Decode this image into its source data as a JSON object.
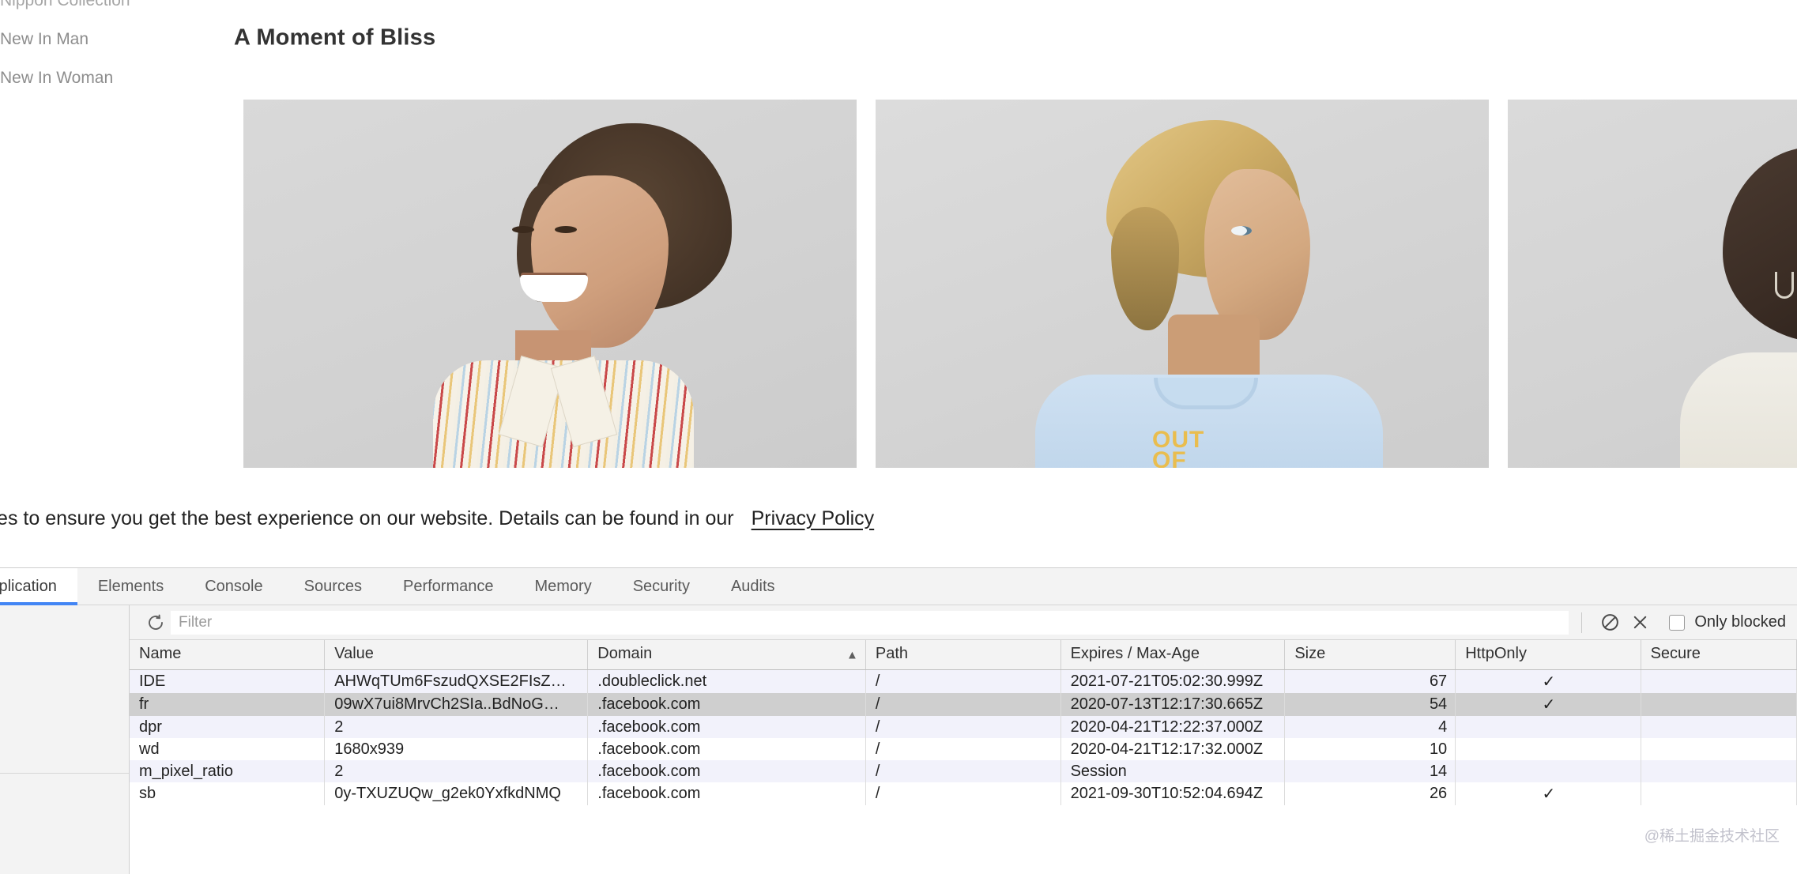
{
  "site": {
    "nav": [
      {
        "label": "Nippon Collection"
      },
      {
        "label": "New In Man"
      },
      {
        "label": "New In Woman"
      }
    ],
    "heading": "A Moment of Bliss",
    "gallery": [
      {
        "alt": "smiling-man-striped-shirt",
        "tee_text": ""
      },
      {
        "alt": "blond-man-profile-blue-tee",
        "tee_text": "OUT\nOF"
      },
      {
        "alt": "woman-cream-sweater",
        "tee_text": ""
      }
    ],
    "cookie_banner": {
      "text": "kies to ensure you get the best experience on our website. Details can be found in our",
      "link_label": "Privacy Policy"
    }
  },
  "devtools": {
    "tabs": [
      {
        "label": "Application",
        "active": true
      },
      {
        "label": "Elements",
        "active": false
      },
      {
        "label": "Console",
        "active": false
      },
      {
        "label": "Sources",
        "active": false
      },
      {
        "label": "Performance",
        "active": false
      },
      {
        "label": "Memory",
        "active": false
      },
      {
        "label": "Security",
        "active": false
      },
      {
        "label": "Audits",
        "active": false
      }
    ],
    "toolbar": {
      "refresh_icon": "refresh-icon",
      "filter_placeholder": "Filter",
      "filter_value": "",
      "clear_filter_icon": "block-icon",
      "delete_icon": "close-icon",
      "only_blocked_label": "Only blocked",
      "only_blocked_checked": false
    },
    "table": {
      "columns": [
        {
          "key": "name",
          "label": "Name",
          "sorted": false
        },
        {
          "key": "value",
          "label": "Value",
          "sorted": false
        },
        {
          "key": "domain",
          "label": "Domain",
          "sorted": true,
          "sort_dir": "▲"
        },
        {
          "key": "path",
          "label": "Path",
          "sorted": false
        },
        {
          "key": "expires",
          "label": "Expires / Max-Age",
          "sorted": false
        },
        {
          "key": "size",
          "label": "Size",
          "sorted": false
        },
        {
          "key": "httponly",
          "label": "HttpOnly",
          "sorted": false
        },
        {
          "key": "secure",
          "label": "Secure",
          "sorted": false
        }
      ],
      "rows": [
        {
          "name": "IDE",
          "value": "AHWqTUm6FszudQXSE2FIsZ…",
          "domain": ".doubleclick.net",
          "path": "/",
          "expires": "2021-07-21T05:02:30.999Z",
          "size": "67",
          "httponly": "✓",
          "secure": "",
          "selected": false
        },
        {
          "name": "fr",
          "value": "09wX7ui8MrvCh2SIa..BdNoG…",
          "domain": ".facebook.com",
          "path": "/",
          "expires": "2020-07-13T12:17:30.665Z",
          "size": "54",
          "httponly": "✓",
          "secure": "",
          "selected": true
        },
        {
          "name": "dpr",
          "value": "2",
          "domain": ".facebook.com",
          "path": "/",
          "expires": "2020-04-21T12:22:37.000Z",
          "size": "4",
          "httponly": "",
          "secure": "",
          "selected": false
        },
        {
          "name": "wd",
          "value": "1680x939",
          "domain": ".facebook.com",
          "path": "/",
          "expires": "2020-04-21T12:17:32.000Z",
          "size": "10",
          "httponly": "",
          "secure": "",
          "selected": false
        },
        {
          "name": "m_pixel_ratio",
          "value": "2",
          "domain": ".facebook.com",
          "path": "/",
          "expires": "Session",
          "size": "14",
          "httponly": "",
          "secure": "",
          "selected": false
        },
        {
          "name": "sb",
          "value": "0y-TXUZUQw_g2ek0YxfkdNMQ",
          "domain": ".facebook.com",
          "path": "/",
          "expires": "2021-09-30T10:52:04.694Z",
          "size": "26",
          "httponly": "✓",
          "secure": "",
          "selected": false
        }
      ]
    }
  },
  "watermark": "@稀土掘金技术社区",
  "colors": {
    "accent": "#4285f4",
    "selected_row": "#cfcfcf",
    "stripe": "#f2f2fb",
    "toolbar_bg": "#f3f3f3"
  }
}
